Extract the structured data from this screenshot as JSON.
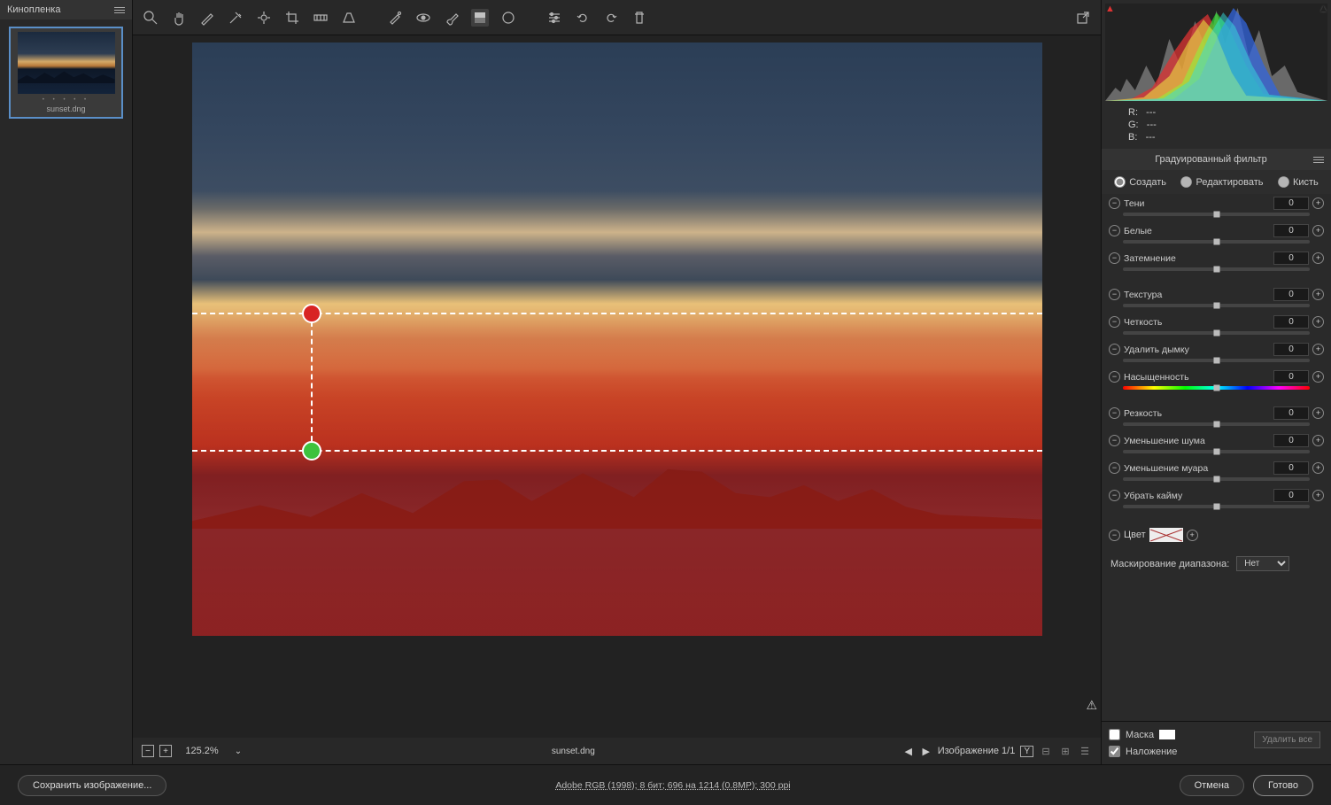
{
  "filmstrip": {
    "title": "Кинопленка",
    "thumb_name": "sunset.dng"
  },
  "zoom": {
    "value": "125.2%"
  },
  "status": {
    "filename": "sunset.dng",
    "image_counter": "Изображение 1/1",
    "y_label": "Y"
  },
  "rgb": {
    "r_label": "R:",
    "g_label": "G:",
    "b_label": "B:",
    "dash": "---"
  },
  "panel": {
    "title": "Градуированный фильтр"
  },
  "modes": {
    "create": "Создать",
    "edit": "Редактировать",
    "brush": "Кисть"
  },
  "sliders": {
    "shadows": {
      "label": "Тени",
      "val": "0"
    },
    "whites": {
      "label": "Белые",
      "val": "0"
    },
    "blacks": {
      "label": "Затемнение",
      "val": "0"
    },
    "texture": {
      "label": "Текстура",
      "val": "0"
    },
    "clarity": {
      "label": "Четкость",
      "val": "0"
    },
    "dehaze": {
      "label": "Удалить дымку",
      "val": "0"
    },
    "saturation": {
      "label": "Насыщенность",
      "val": "0"
    },
    "sharpness": {
      "label": "Резкость",
      "val": "0"
    },
    "noise": {
      "label": "Уменьшение шума",
      "val": "0"
    },
    "moire": {
      "label": "Уменьшение муара",
      "val": "0"
    },
    "fringe": {
      "label": "Убрать кайму",
      "val": "0"
    }
  },
  "color_label": "Цвет",
  "range_mask": {
    "label": "Маскирование диапазона:",
    "value": "Нет"
  },
  "checks": {
    "mask": "Маска",
    "overlay": "Наложение"
  },
  "delete_all": "Удалить все",
  "footer": {
    "save": "Сохранить изображение...",
    "info": "Adobe RGB (1998); 8 бит; 696 на 1214 (0.8MP); 300 ppi",
    "cancel": "Отмена",
    "done": "Готово"
  }
}
